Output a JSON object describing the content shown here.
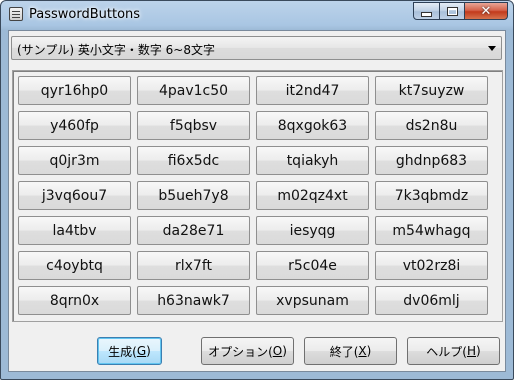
{
  "window": {
    "title": "PasswordButtons"
  },
  "combo": {
    "selected": "(サンプル) 英小文字・数字 6~8文字"
  },
  "passwords": [
    "qyr16hp0",
    "4pav1c50",
    "it2nd47",
    "kt7suyzw",
    "y460fp",
    "f5qbsv",
    "8qxgok63",
    "ds2n8u",
    "q0jr3m",
    "fi6x5dc",
    "tqiakyh",
    "ghdnp683",
    "j3vq6ou7",
    "b5ueh7y8",
    "m02qz4xt",
    "7k3qbmdz",
    "la4tbv",
    "da28e71",
    "iesyqg",
    "m54whagq",
    "c4oybtq",
    "rlx7ft",
    "r5c04e",
    "vt02rz8i",
    "8qrn0x",
    "h63nawk7",
    "xvpsunam",
    "dv06mlj"
  ],
  "buttons": {
    "generate": {
      "label": "生成(",
      "key": "G",
      "suffix": ")"
    },
    "options": {
      "label": "オプション(",
      "key": "O",
      "suffix": ")"
    },
    "exit": {
      "label": "終了(",
      "key": "X",
      "suffix": ")"
    },
    "help": {
      "label": "ヘルプ(",
      "key": "H",
      "suffix": ")"
    }
  }
}
